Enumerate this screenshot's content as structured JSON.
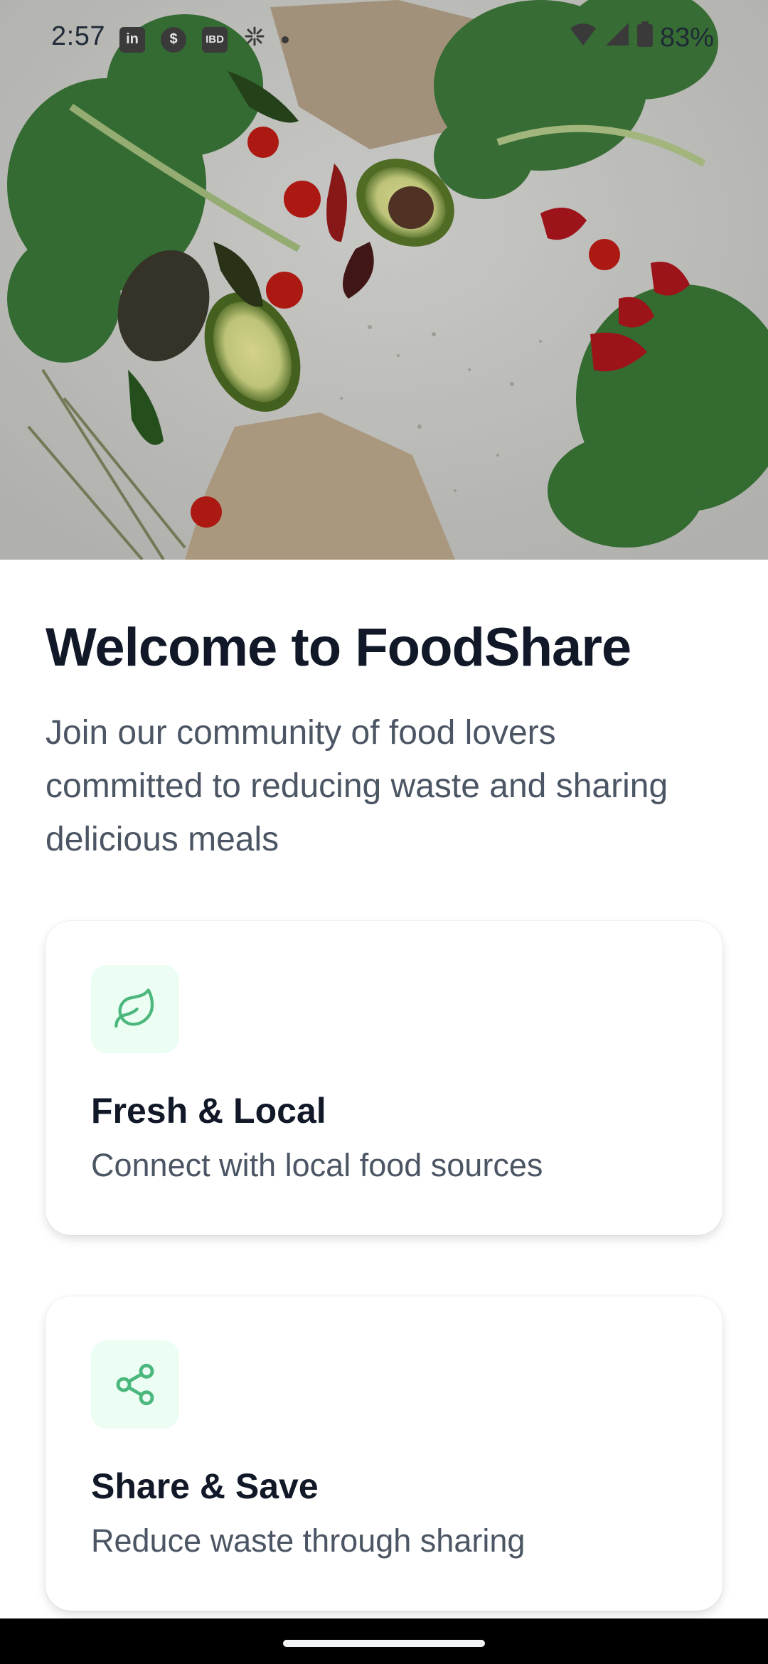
{
  "status_bar": {
    "time": "2:57",
    "notification_icons": [
      "linkedin-icon",
      "dollar-icon",
      "ibd-icon",
      "pinwheel-icon",
      "dot-icon"
    ],
    "ibd_text": "IBD",
    "linkedin_text": "in",
    "dollar_text": "$",
    "battery_percent": "83%"
  },
  "hero": {
    "image": "vegetables-hero-image"
  },
  "welcome": {
    "title": "Welcome to FoodShare",
    "subtitle": "Join our community of food lovers committed to reducing waste and sharing delicious meals"
  },
  "features": [
    {
      "icon": "leaf-icon",
      "title": "Fresh & Local",
      "description": "Connect with local food sources"
    },
    {
      "icon": "share-icon",
      "title": "Share & Save",
      "description": "Reduce waste through sharing"
    }
  ],
  "colors": {
    "accent": "#4ab77c",
    "icon_bg": "#ecfdf3",
    "title": "#111827",
    "body": "#4b5563"
  }
}
